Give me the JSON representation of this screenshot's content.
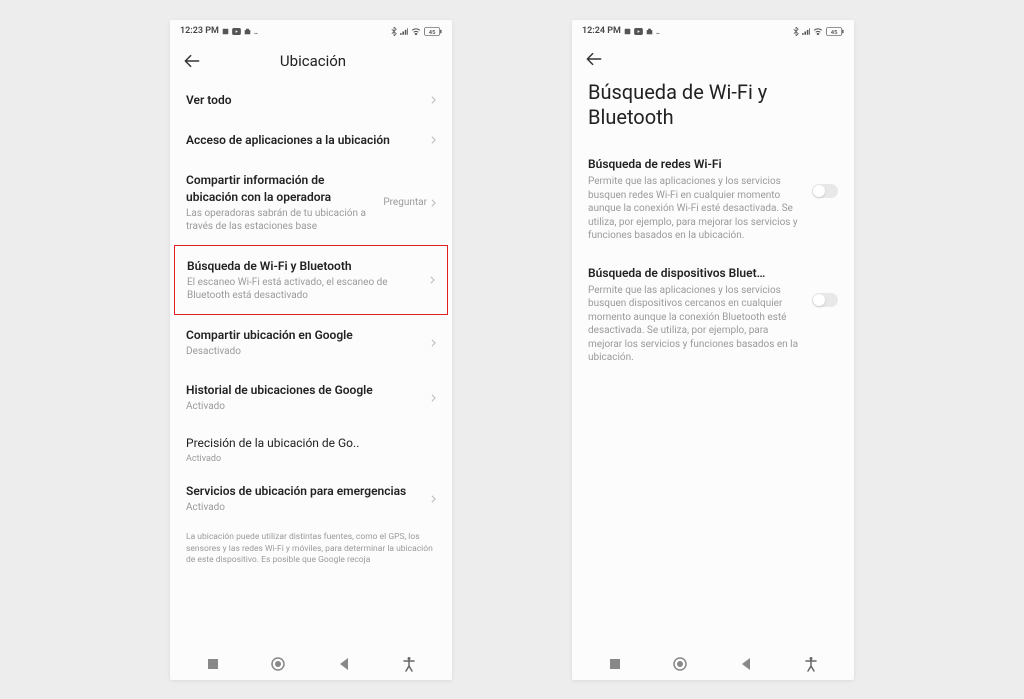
{
  "left": {
    "time": "12:23 PM",
    "battery": "45",
    "header_title": "Ubicación",
    "items": [
      {
        "title": "Ver todo",
        "sub": "",
        "right": ""
      },
      {
        "title": "Acceso de aplicaciones a la ubicación",
        "sub": "",
        "right": ""
      },
      {
        "title": "Compartir información de ubicación con la operadora",
        "sub": "Las operadoras sabrán de tu ubicación a través de las estaciones base",
        "right": "Preguntar"
      },
      {
        "title": "Búsqueda de Wi-Fi y Bluetooth",
        "sub": "El escaneo Wi-Fi está activado, el escaneo de Bluetooth está desactivado",
        "right": ""
      },
      {
        "title": "Compartir ubicación en Google",
        "sub": "Desactivado",
        "right": ""
      },
      {
        "title": "Historial de ubicaciones de Google",
        "sub": "Activado",
        "right": ""
      },
      {
        "title": "Precisión de la ubicación de Go..",
        "sub": "Activado",
        "right": ""
      },
      {
        "title": "Servicios de ubicación para emergencias",
        "sub": "Activado",
        "right": ""
      }
    ],
    "footer": "La ubicación puede utilizar distintas fuentes, como el GPS, los sensores y las redes Wi-Fi y móviles, para determinar la ubicación de este dispositivo. Es posible que Google recoja"
  },
  "right": {
    "time": "12:24 PM",
    "battery": "45",
    "page_title": "Búsqueda de Wi-Fi y Bluetooth",
    "settings": [
      {
        "title": "Búsqueda de redes Wi-Fi",
        "desc": "Permite que las aplicaciones y los servicios busquen redes Wi-Fi en cualquier momento aunque la conexión Wi-Fi esté desactivada. Se utiliza, por ejemplo, para mejorar los servicios y funciones basados en la ubicación."
      },
      {
        "title": "Búsqueda de dispositivos Bluet…",
        "desc": "Permite que las aplicaciones y los servicios busquen dispositivos cercanos en cualquier momento aunque la conexión Bluetooth esté desactivada. Se utiliza, por ejemplo, para mejorar los servicios y funciones basados en la ubicación."
      }
    ]
  }
}
